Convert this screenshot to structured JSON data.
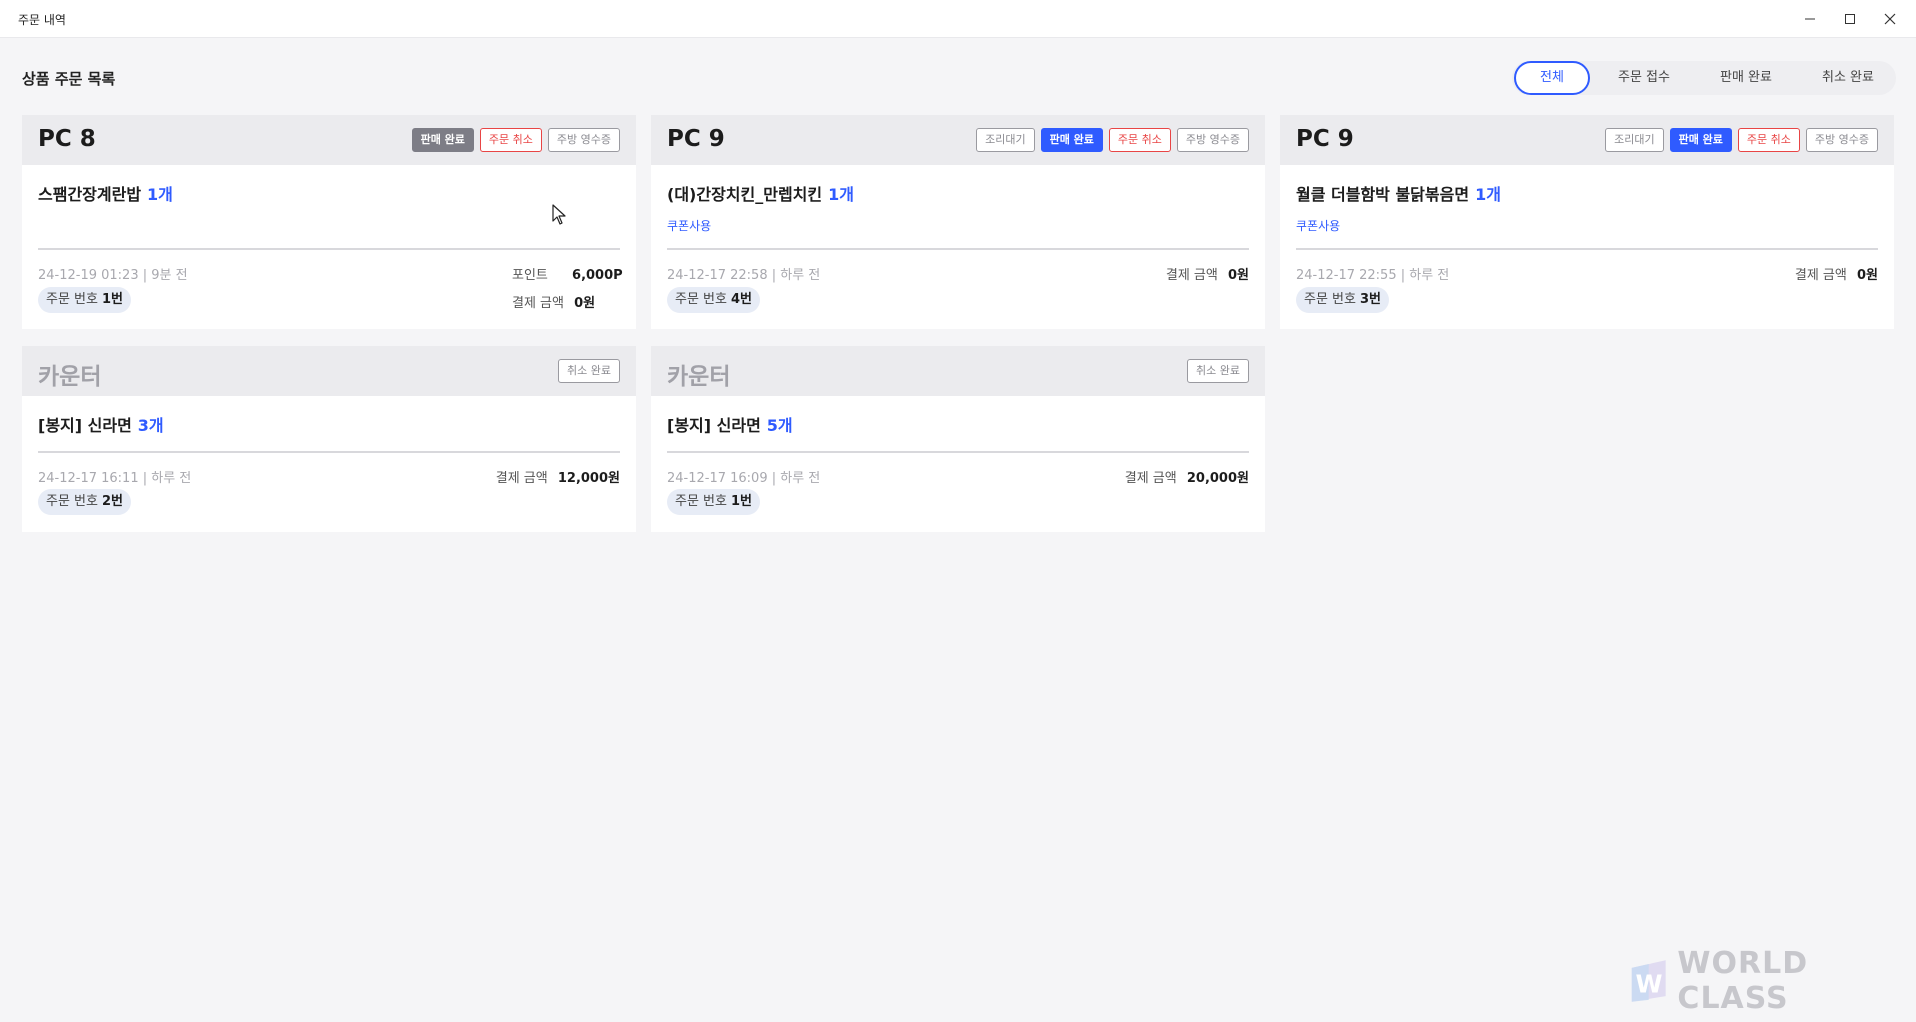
{
  "window": {
    "title": "주문 내역",
    "controls": [
      "minimize-icon",
      "maximize-icon",
      "close-icon"
    ]
  },
  "header": {
    "title": "상품 주문 목록",
    "filters": [
      {
        "label": "전체",
        "active": true
      },
      {
        "label": "주문 접수",
        "active": false
      },
      {
        "label": "판매 완료",
        "active": false
      },
      {
        "label": "취소 완료",
        "active": false
      }
    ]
  },
  "orders": [
    {
      "seat": "PC 8",
      "badges": [
        {
          "label": "판매 완료",
          "style": "gray"
        },
        {
          "label": "주문 취소",
          "style": "red-outline"
        },
        {
          "label": "주방 영수증",
          "style": "gray-outline"
        }
      ],
      "item": "스팸간장계란밥",
      "qty": "1개",
      "coupon": "",
      "time": "24-12-19 01:23 | 9분 전",
      "order_label": "주문 번호",
      "order_no": "1번",
      "point_label": "포인트",
      "point_value": "6,000P",
      "pay_label": "결제 금액",
      "pay_value": "0원"
    },
    {
      "seat": "PC 9",
      "badges": [
        {
          "label": "조리대기",
          "style": "gray-outline"
        },
        {
          "label": "판매 완료",
          "style": "blue"
        },
        {
          "label": "주문 취소",
          "style": "red-outline"
        },
        {
          "label": "주방 영수증",
          "style": "gray-outline"
        }
      ],
      "item": "(대)간장치킨_만렙치킨",
      "qty": "1개",
      "coupon": "쿠폰사용",
      "time": "24-12-17 22:58 | 하루 전",
      "order_label": "주문 번호",
      "order_no": "4번",
      "pay_label": "결제 금액",
      "pay_value": "0원"
    },
    {
      "seat": "PC 9",
      "badges": [
        {
          "label": "조리대기",
          "style": "gray-outline"
        },
        {
          "label": "판매 완료",
          "style": "blue"
        },
        {
          "label": "주문 취소",
          "style": "red-outline"
        },
        {
          "label": "주방 영수증",
          "style": "gray-outline"
        }
      ],
      "item": "월클 더블함박 불닭볶음면",
      "qty": "1개",
      "coupon": "쿠폰사용",
      "time": "24-12-17 22:55 | 하루 전",
      "order_label": "주문 번호",
      "order_no": "3번",
      "pay_label": "결제 금액",
      "pay_value": "0원"
    },
    {
      "seat": "카운터",
      "badges": [
        {
          "label": "취소 완료",
          "style": "gray-outline"
        }
      ],
      "item": "[봉지] 신라면",
      "qty": "3개",
      "coupon": "",
      "time": "24-12-17 16:11 | 하루 전",
      "order_label": "주문 번호",
      "order_no": "2번",
      "pay_label": "결제 금액",
      "pay_value": "12,000원"
    },
    {
      "seat": "카운터",
      "badges": [
        {
          "label": "취소 완료",
          "style": "gray-outline"
        }
      ],
      "item": "[봉지] 신라면",
      "qty": "5개",
      "coupon": "",
      "time": "24-12-17 16:09 | 하루 전",
      "order_label": "주문 번호",
      "order_no": "1번",
      "pay_label": "결제 금액",
      "pay_value": "20,000원"
    }
  ],
  "watermark": {
    "logo": "world-class-logo-icon",
    "text": "WORLD CLASS"
  }
}
